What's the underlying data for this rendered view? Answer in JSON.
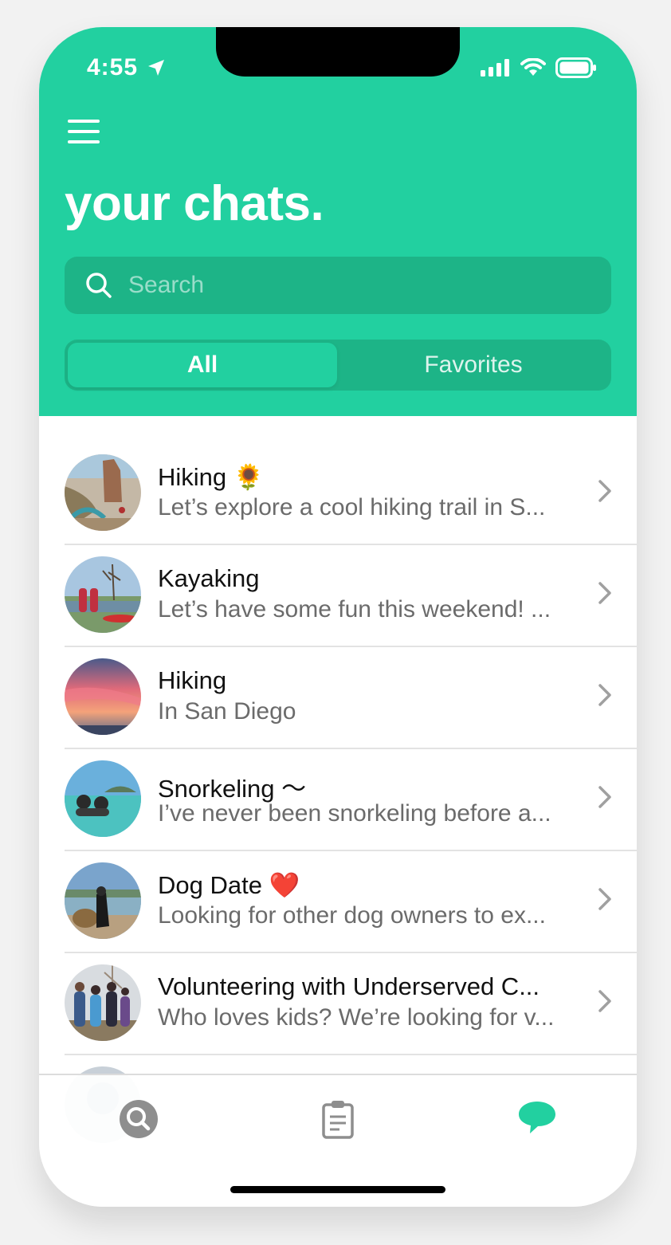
{
  "status": {
    "time": "4:55"
  },
  "header": {
    "title": "your chats."
  },
  "search": {
    "placeholder": "Search"
  },
  "tabs": {
    "all": "All",
    "favorites": "Favorites"
  },
  "chats": [
    {
      "title": "Hiking 🌻",
      "subtitle": "Let’s explore a cool hiking trail in S..."
    },
    {
      "title": "Kayaking",
      "subtitle": "Let’s have some fun this weekend! ..."
    },
    {
      "title": "Hiking",
      "subtitle": "In San Diego"
    },
    {
      "title": "Snorkeling ～",
      "subtitle": "I’ve never been snorkeling before a..."
    },
    {
      "title": "Dog Date ❤️",
      "subtitle": "Looking for other dog owners to ex..."
    },
    {
      "title": "Volunteering with Underserved C...",
      "subtitle": "Who loves kids? We’re looking for v..."
    }
  ],
  "colors": {
    "brand": "#22d0a0",
    "brand_dark": "#1db487",
    "chevron": "#a0a0a0"
  },
  "tabbar": {
    "icons": [
      "search-icon",
      "clipboard-icon",
      "chat-bubble-icon"
    ],
    "active": "chat-bubble-icon"
  }
}
